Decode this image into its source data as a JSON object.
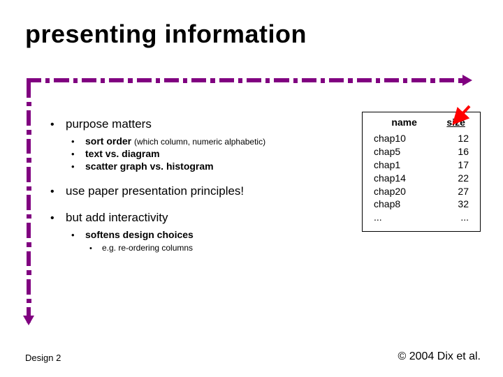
{
  "title": "presenting information",
  "bullets": {
    "item1": {
      "label": "purpose matters",
      "sub1": "sort order",
      "sub1_paren": "(which column, numeric alphabetic)",
      "sub2": "text vs. diagram",
      "sub3": "scatter graph vs. histogram"
    },
    "item2": {
      "label": "use paper presentation principles!"
    },
    "item3": {
      "label": "but add interactivity",
      "sub1": "softens design choices",
      "sub1_sub1": "e.g. re-ordering columns"
    }
  },
  "table": {
    "headers": {
      "name": "name",
      "size": "size"
    },
    "rows": [
      {
        "name": "chap10",
        "size": "12"
      },
      {
        "name": "chap5",
        "size": "16"
      },
      {
        "name": "chap1",
        "size": "17"
      },
      {
        "name": "chap14",
        "size": "22"
      },
      {
        "name": "chap20",
        "size": "27"
      },
      {
        "name": "chap8",
        "size": "32"
      },
      {
        "name": "...",
        "size": "..."
      }
    ]
  },
  "footer": {
    "left": "Design 2",
    "right": "© 2004 Dix et al."
  },
  "colors": {
    "accent": "#800080",
    "arrow": "#ff0000"
  }
}
